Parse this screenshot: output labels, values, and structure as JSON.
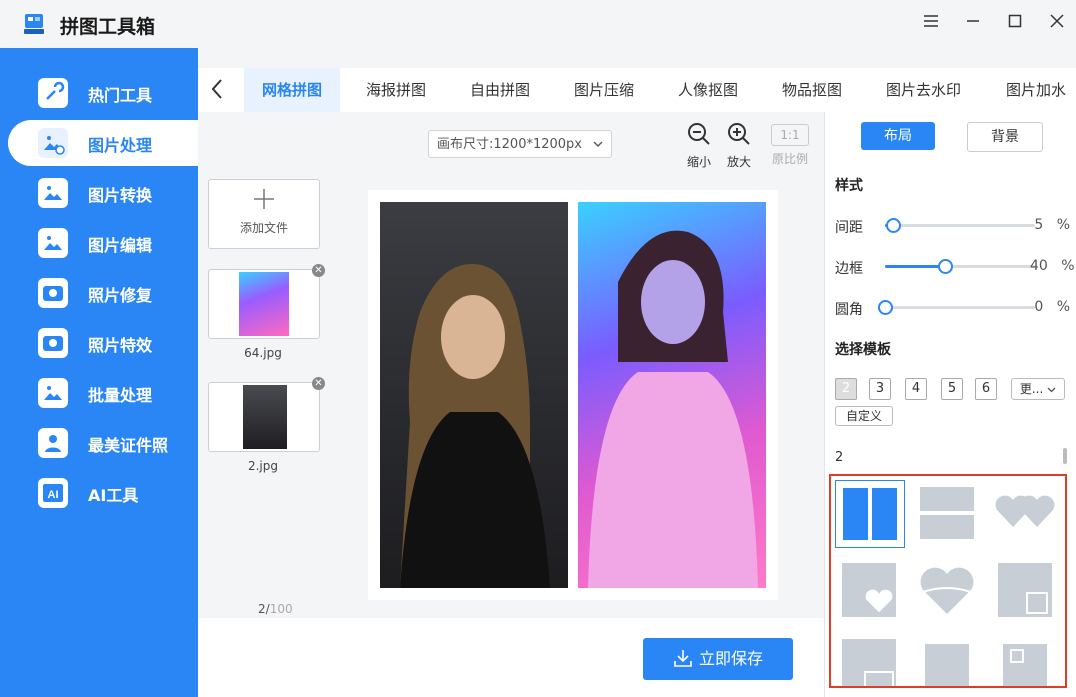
{
  "app": {
    "title": "拼图工具箱"
  },
  "window": {
    "menu_icon": "hamburger-icon",
    "min_icon": "minimize-icon",
    "max_icon": "maximize-icon",
    "close_icon": "close-icon"
  },
  "sidebar": {
    "items": [
      {
        "label": "热门工具",
        "icon": "tools-icon"
      },
      {
        "label": "图片处理",
        "icon": "image-process-icon",
        "active": true
      },
      {
        "label": "图片转换",
        "icon": "image-convert-icon"
      },
      {
        "label": "图片编辑",
        "icon": "image-edit-icon"
      },
      {
        "label": "照片修复",
        "icon": "photo-repair-icon"
      },
      {
        "label": "照片特效",
        "icon": "photo-effect-icon"
      },
      {
        "label": "批量处理",
        "icon": "batch-icon"
      },
      {
        "label": "最美证件照",
        "icon": "id-photo-icon"
      },
      {
        "label": "AI工具",
        "icon": "ai-icon"
      }
    ]
  },
  "tabs": [
    "网格拼图",
    "海报拼图",
    "自由拼图",
    "图片压缩",
    "人像抠图",
    "物品抠图",
    "图片去水印",
    "图片加水"
  ],
  "toolbar": {
    "canvas_size": "画布尺寸:1200*1200px",
    "zoom_out": "缩小",
    "zoom_in": "放大",
    "ratio_box": "1:1",
    "ratio_label": "原比例"
  },
  "files": {
    "add_label": "添加文件",
    "items": [
      {
        "name": "64.jpg"
      },
      {
        "name": "2.jpg"
      }
    ],
    "count_current": "2/",
    "count_total": "100"
  },
  "save_button": "立即保存",
  "panel": {
    "tab_layout": "布局",
    "tab_background": "背景",
    "style_title": "样式",
    "sliders": [
      {
        "label": "间距",
        "value": "5",
        "unit": "%",
        "level": 0.05
      },
      {
        "label": "边框",
        "value": "40",
        "unit": "%",
        "level": 0.4
      },
      {
        "label": "圆角",
        "value": "0",
        "unit": "%",
        "level": 0.0
      }
    ],
    "template_title": "选择模板",
    "counts": [
      "2",
      "3",
      "4",
      "5",
      "6"
    ],
    "more": "更...",
    "custom": "自定义",
    "current_count": "2"
  },
  "colors": {
    "accent": "#2a86f4",
    "highlight_border": "#e23b26"
  }
}
